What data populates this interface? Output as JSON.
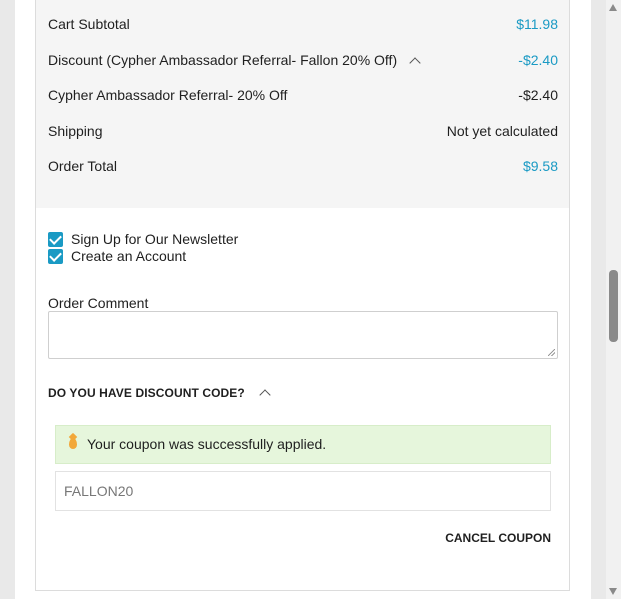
{
  "totals": {
    "subtotal": {
      "label": "Cart Subtotal",
      "value": "$11.98"
    },
    "discount": {
      "label": "Discount (Cypher Ambassador Referral- Fallon 20% Off)",
      "value": "-$2.40"
    },
    "discount_detail": {
      "label": "Cypher Ambassador Referral- 20% Off",
      "value": "-$2.40"
    },
    "shipping": {
      "label": "Shipping",
      "value": "Not yet calculated"
    },
    "order_total": {
      "label": "Order Total",
      "value": "$9.58"
    }
  },
  "options": {
    "newsletter": {
      "label": "Sign Up for Our Newsletter",
      "checked": true
    },
    "create_account": {
      "label": "Create an Account",
      "checked": true
    }
  },
  "comment": {
    "label": "Order Comment",
    "value": ""
  },
  "discount_code": {
    "heading": "DO YOU HAVE DISCOUNT CODE?",
    "success_message": "Your coupon was successfully applied.",
    "code_value": "FALLON20",
    "cancel_label": "CANCEL COUPON"
  },
  "colors": {
    "accent": "#1a9ac4",
    "success_bg": "#e6f6dc",
    "totals_bg": "#f5f5f5"
  }
}
